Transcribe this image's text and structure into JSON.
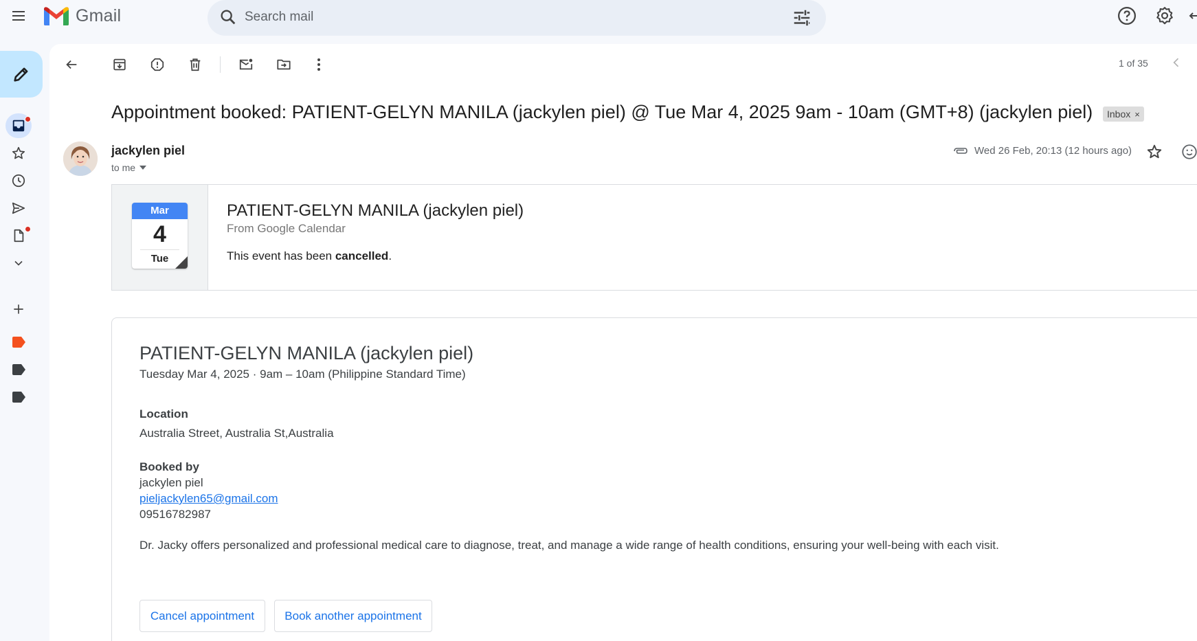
{
  "app": {
    "name": "Gmail"
  },
  "search": {
    "placeholder": "Search mail"
  },
  "toolbar": {
    "pager": "1 of 35"
  },
  "email": {
    "subject": "Appointment booked: PATIENT-GELYN MANILA (jackylen piel) @ Tue Mar 4, 2025 9am - 10am (GMT+8) (jackylen piel)",
    "label_chip": "Inbox",
    "label_remove": "×",
    "sender": "jackylen piel",
    "to": "to me",
    "date": "Wed 26 Feb, 20:13 (12 hours ago)"
  },
  "calendar_card": {
    "month": "Mar",
    "day": "4",
    "weekday": "Tue",
    "title": "PATIENT-GELYN MANILA (jackylen piel)",
    "from": "From Google Calendar",
    "message_prefix": "This event has been ",
    "message_status": "cancelled",
    "message_suffix": "."
  },
  "details": {
    "title": "PATIENT-GELYN MANILA (jackylen piel)",
    "when": "Tuesday Mar 4, 2025 · 9am – 10am (Philippine Standard Time)",
    "location_label": "Location",
    "location": "Australia Street, Australia St,Australia",
    "booked_by_label": "Booked by",
    "booked_by_name": "jackylen piel",
    "booked_by_email": "pieljackylen65@gmail.com",
    "booked_by_phone": "09516782987",
    "description": "Dr. Jacky offers personalized and professional medical care to diagnose, treat, and manage a wide range of health conditions, ensuring your well-being with each visit.",
    "cancel_button": "Cancel appointment",
    "book_button": "Book another appointment"
  },
  "colors": {
    "compose_bg": "#c2e7ff",
    "link": "#1a73e8",
    "calendar_blue": "#4285f4",
    "notification_dot": "#d93025"
  },
  "icons": [
    "menu-icon",
    "gmail-logo-icon",
    "search-icon",
    "tune-icon",
    "help-icon",
    "settings-icon",
    "pencil-icon",
    "inbox-icon",
    "star-icon",
    "clock-icon",
    "send-icon",
    "draft-icon",
    "chevron-down-icon",
    "plus-icon",
    "label-icon",
    "back-arrow-icon",
    "archive-icon",
    "report-spam-icon",
    "delete-icon",
    "mark-unread-icon",
    "move-to-icon",
    "more-vert-icon",
    "chevron-left-icon",
    "attachment-icon",
    "emoji-icon"
  ]
}
